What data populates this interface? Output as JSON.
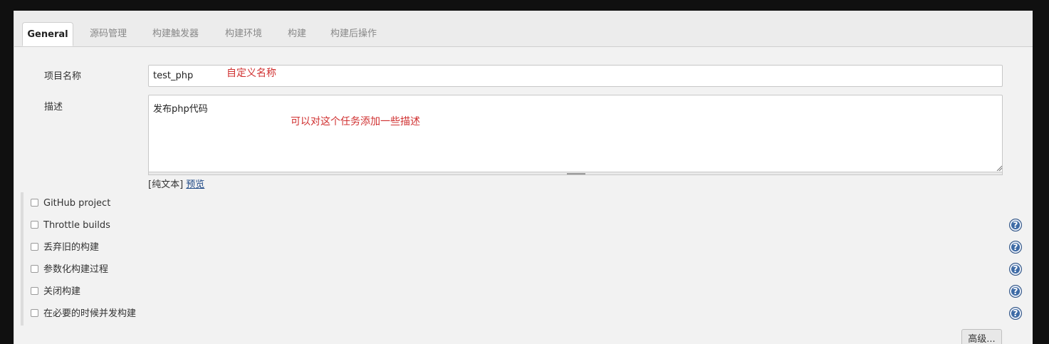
{
  "tabs": [
    {
      "label": "General",
      "active": true
    },
    {
      "label": "源码管理"
    },
    {
      "label": "构建触发器"
    },
    {
      "label": "构建环境"
    },
    {
      "label": "构建"
    },
    {
      "label": "构建后操作"
    }
  ],
  "form": {
    "name_label": "项目名称",
    "name_value": "test_php",
    "name_annotation": "自定义名称",
    "desc_label": "描述",
    "desc_value": "发布php代码",
    "desc_annotation": "可以对这个任务添加一些描述",
    "plain_text_label": "[纯文本]",
    "preview_link": "预览"
  },
  "options": [
    {
      "label": "GitHub project",
      "help": false
    },
    {
      "label": "Throttle builds",
      "help": true
    },
    {
      "label": "丢弃旧的构建",
      "help": true
    },
    {
      "label": "参数化构建过程",
      "help": true
    },
    {
      "label": "关闭构建",
      "help": true
    },
    {
      "label": "在必要的时候并发构建",
      "help": true
    }
  ],
  "help_icon_glyph": "?",
  "advanced_button": "高级...",
  "colors": {
    "annotation": "#d03030",
    "help_icon": "#3d6aa5",
    "link": "#204a87"
  }
}
